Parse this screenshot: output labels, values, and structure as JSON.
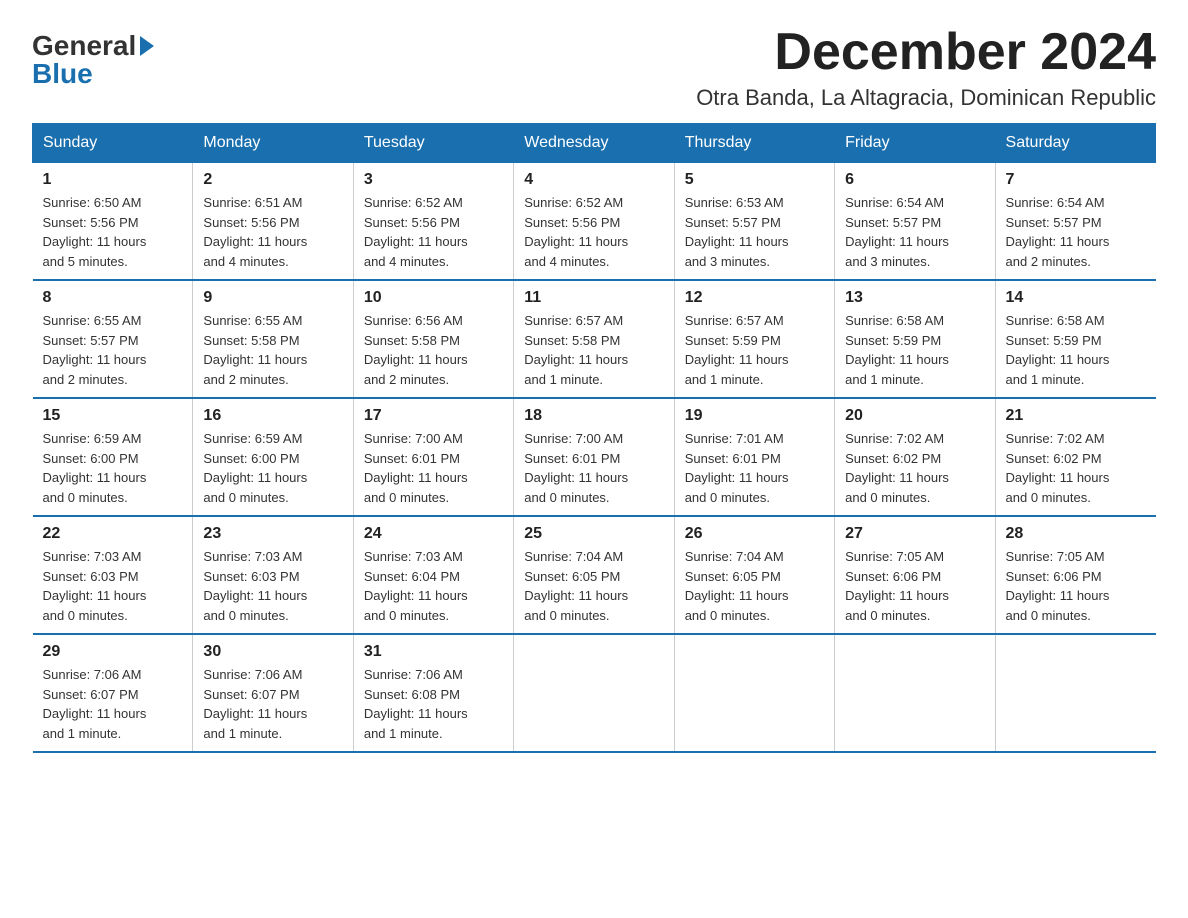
{
  "logo": {
    "general": "General",
    "blue": "Blue"
  },
  "header": {
    "month_year": "December 2024",
    "location": "Otra Banda, La Altagracia, Dominican Republic"
  },
  "days_of_week": [
    "Sunday",
    "Monday",
    "Tuesday",
    "Wednesday",
    "Thursday",
    "Friday",
    "Saturday"
  ],
  "weeks": [
    [
      {
        "day": "1",
        "sunrise": "6:50 AM",
        "sunset": "5:56 PM",
        "daylight": "11 hours and 5 minutes."
      },
      {
        "day": "2",
        "sunrise": "6:51 AM",
        "sunset": "5:56 PM",
        "daylight": "11 hours and 4 minutes."
      },
      {
        "day": "3",
        "sunrise": "6:52 AM",
        "sunset": "5:56 PM",
        "daylight": "11 hours and 4 minutes."
      },
      {
        "day": "4",
        "sunrise": "6:52 AM",
        "sunset": "5:56 PM",
        "daylight": "11 hours and 4 minutes."
      },
      {
        "day": "5",
        "sunrise": "6:53 AM",
        "sunset": "5:57 PM",
        "daylight": "11 hours and 3 minutes."
      },
      {
        "day": "6",
        "sunrise": "6:54 AM",
        "sunset": "5:57 PM",
        "daylight": "11 hours and 3 minutes."
      },
      {
        "day": "7",
        "sunrise": "6:54 AM",
        "sunset": "5:57 PM",
        "daylight": "11 hours and 2 minutes."
      }
    ],
    [
      {
        "day": "8",
        "sunrise": "6:55 AM",
        "sunset": "5:57 PM",
        "daylight": "11 hours and 2 minutes."
      },
      {
        "day": "9",
        "sunrise": "6:55 AM",
        "sunset": "5:58 PM",
        "daylight": "11 hours and 2 minutes."
      },
      {
        "day": "10",
        "sunrise": "6:56 AM",
        "sunset": "5:58 PM",
        "daylight": "11 hours and 2 minutes."
      },
      {
        "day": "11",
        "sunrise": "6:57 AM",
        "sunset": "5:58 PM",
        "daylight": "11 hours and 1 minute."
      },
      {
        "day": "12",
        "sunrise": "6:57 AM",
        "sunset": "5:59 PM",
        "daylight": "11 hours and 1 minute."
      },
      {
        "day": "13",
        "sunrise": "6:58 AM",
        "sunset": "5:59 PM",
        "daylight": "11 hours and 1 minute."
      },
      {
        "day": "14",
        "sunrise": "6:58 AM",
        "sunset": "5:59 PM",
        "daylight": "11 hours and 1 minute."
      }
    ],
    [
      {
        "day": "15",
        "sunrise": "6:59 AM",
        "sunset": "6:00 PM",
        "daylight": "11 hours and 0 minutes."
      },
      {
        "day": "16",
        "sunrise": "6:59 AM",
        "sunset": "6:00 PM",
        "daylight": "11 hours and 0 minutes."
      },
      {
        "day": "17",
        "sunrise": "7:00 AM",
        "sunset": "6:01 PM",
        "daylight": "11 hours and 0 minutes."
      },
      {
        "day": "18",
        "sunrise": "7:00 AM",
        "sunset": "6:01 PM",
        "daylight": "11 hours and 0 minutes."
      },
      {
        "day": "19",
        "sunrise": "7:01 AM",
        "sunset": "6:01 PM",
        "daylight": "11 hours and 0 minutes."
      },
      {
        "day": "20",
        "sunrise": "7:02 AM",
        "sunset": "6:02 PM",
        "daylight": "11 hours and 0 minutes."
      },
      {
        "day": "21",
        "sunrise": "7:02 AM",
        "sunset": "6:02 PM",
        "daylight": "11 hours and 0 minutes."
      }
    ],
    [
      {
        "day": "22",
        "sunrise": "7:03 AM",
        "sunset": "6:03 PM",
        "daylight": "11 hours and 0 minutes."
      },
      {
        "day": "23",
        "sunrise": "7:03 AM",
        "sunset": "6:03 PM",
        "daylight": "11 hours and 0 minutes."
      },
      {
        "day": "24",
        "sunrise": "7:03 AM",
        "sunset": "6:04 PM",
        "daylight": "11 hours and 0 minutes."
      },
      {
        "day": "25",
        "sunrise": "7:04 AM",
        "sunset": "6:05 PM",
        "daylight": "11 hours and 0 minutes."
      },
      {
        "day": "26",
        "sunrise": "7:04 AM",
        "sunset": "6:05 PM",
        "daylight": "11 hours and 0 minutes."
      },
      {
        "day": "27",
        "sunrise": "7:05 AM",
        "sunset": "6:06 PM",
        "daylight": "11 hours and 0 minutes."
      },
      {
        "day": "28",
        "sunrise": "7:05 AM",
        "sunset": "6:06 PM",
        "daylight": "11 hours and 0 minutes."
      }
    ],
    [
      {
        "day": "29",
        "sunrise": "7:06 AM",
        "sunset": "6:07 PM",
        "daylight": "11 hours and 1 minute."
      },
      {
        "day": "30",
        "sunrise": "7:06 AM",
        "sunset": "6:07 PM",
        "daylight": "11 hours and 1 minute."
      },
      {
        "day": "31",
        "sunrise": "7:06 AM",
        "sunset": "6:08 PM",
        "daylight": "11 hours and 1 minute."
      },
      null,
      null,
      null,
      null
    ]
  ],
  "labels": {
    "sunrise": "Sunrise:",
    "sunset": "Sunset:",
    "daylight": "Daylight:"
  }
}
